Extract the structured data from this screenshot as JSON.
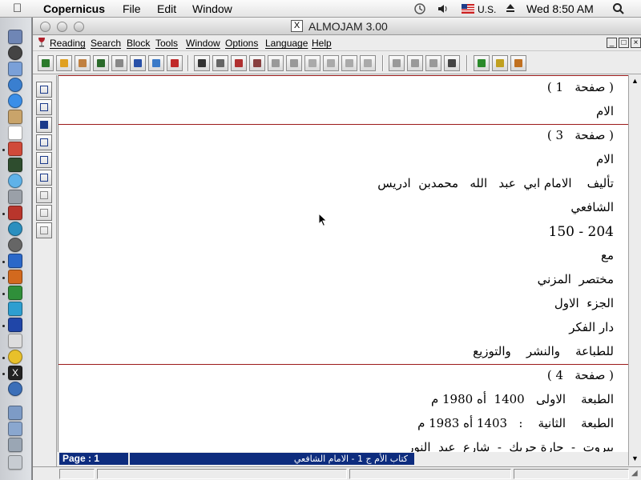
{
  "menubar": {
    "app_name": "Copernicus",
    "items": [
      "File",
      "Edit",
      "Window"
    ],
    "locale": "U.S.",
    "clock": "Wed 8:50 AM"
  },
  "window": {
    "title": "ALMOJAM 3.00",
    "x_logo": "X",
    "menu": [
      "Reading",
      "Search",
      "Block",
      "Tools",
      "Window",
      "Options",
      "Language",
      "Help"
    ]
  },
  "document": {
    "pages": [
      {
        "header": "( صفحة   1 )",
        "lines": [
          "الام"
        ]
      },
      {
        "header": "( صفحة   3 )",
        "lines": [
          "الام",
          "تأليف    الامام ابي  عبد   الله   محمدبن  ادريس",
          "الشافعي",
          "150 - 204",
          "مع",
          "مختصر  المزني",
          "الجزء  الاول",
          "دار الفكر",
          "للطباعة    والنشر    والتوزيع"
        ]
      },
      {
        "header": "( صفحة   4 )",
        "lines": [
          "الطبعة    الاولى   1400  أه 1980 م",
          "الطبعة    الثانية    :   1403 أه 1983 م",
          "بيروت  -  حارة حريك  -  شارع  عبد  النور"
        ]
      }
    ]
  },
  "status": {
    "page": "Page : 1",
    "book": "كتاب الأم ج 1 - الامام الشافعي"
  }
}
